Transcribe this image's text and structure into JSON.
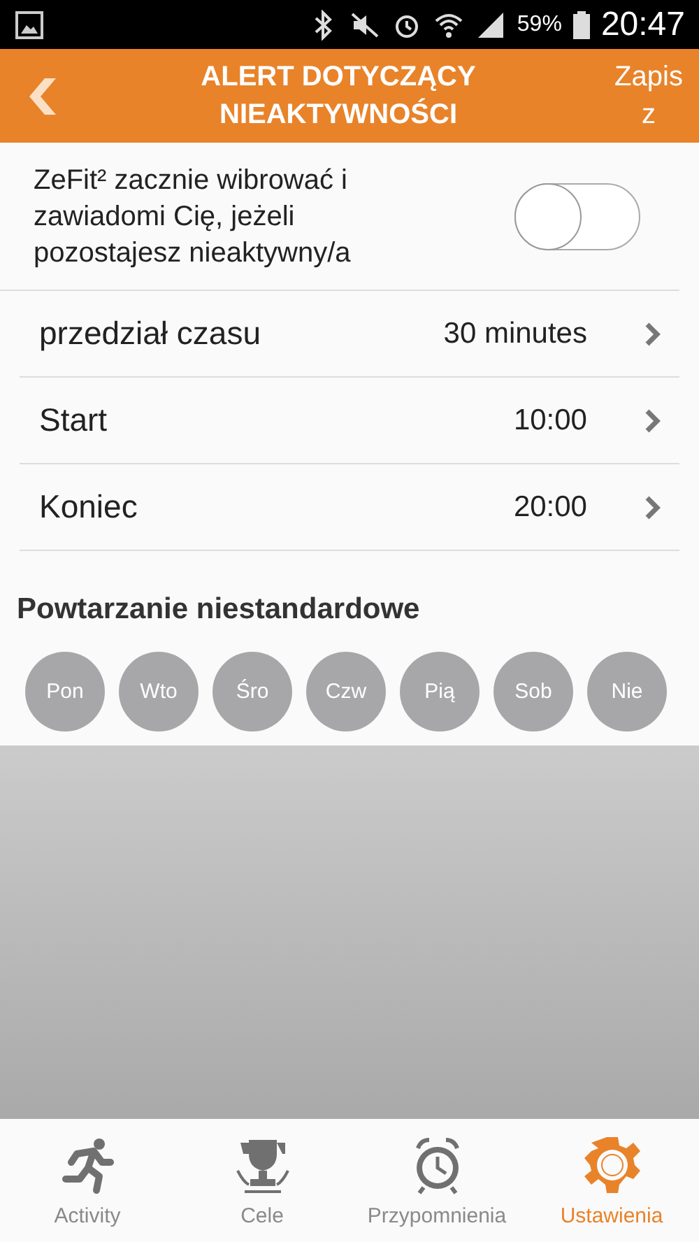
{
  "status_bar": {
    "battery": "59%",
    "time": "20:47"
  },
  "header": {
    "title": "ALERT DOTYCZĄCY NIEAKTYWNOŚCI",
    "action": "Zapisz"
  },
  "alert": {
    "text": "ZeFit² zacznie wibrować i zawiadomi Cię, jeżeli pozostajesz nieaktywny/a",
    "on": false
  },
  "settings": [
    {
      "label": "przedział czasu",
      "value": "30 minutes"
    },
    {
      "label": "Start",
      "value": "10:00"
    },
    {
      "label": "Koniec",
      "value": "20:00"
    }
  ],
  "repeat": {
    "heading": "Powtarzanie niestandardowe",
    "days": [
      {
        "label": "Pon",
        "selected": false
      },
      {
        "label": "Wto",
        "selected": false
      },
      {
        "label": "Śro",
        "selected": false
      },
      {
        "label": "Czw",
        "selected": false
      },
      {
        "label": "Pią",
        "selected": false
      },
      {
        "label": "Sob",
        "selected": false
      },
      {
        "label": "Nie",
        "selected": false
      }
    ]
  },
  "nav": [
    {
      "label": "Activity",
      "kind": "runner",
      "selected": false
    },
    {
      "label": "Cele",
      "kind": "trophy",
      "selected": false
    },
    {
      "label": "Przypomnienia",
      "kind": "alarm",
      "selected": false
    },
    {
      "label": "Ustawienia",
      "kind": "gear",
      "selected": true
    }
  ]
}
